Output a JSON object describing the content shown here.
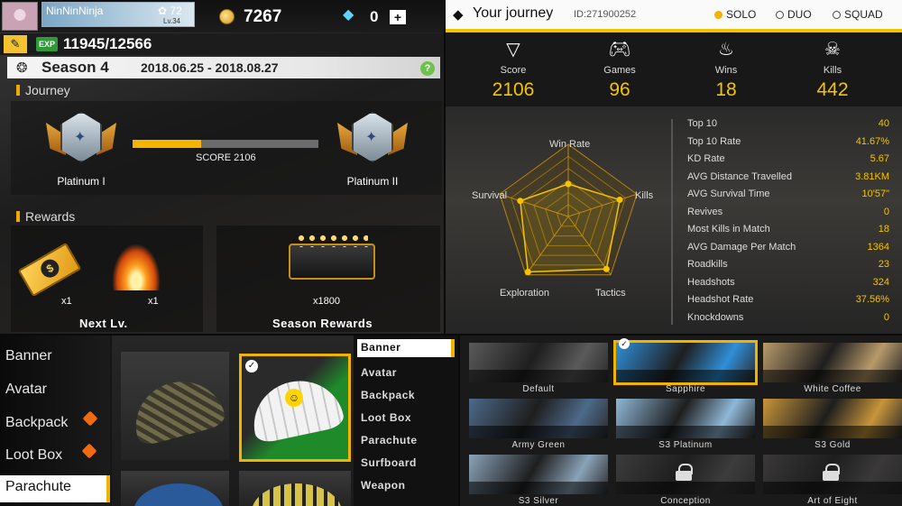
{
  "season_panel": {
    "player_name": "NinNinNinja",
    "likes": "72",
    "level": "Lv.34",
    "coins": "7267",
    "diamonds": "0",
    "plus": "+",
    "exp_tag": "EXP",
    "exp_value": "11945/12566",
    "season_title": "Season 4",
    "season_dates": "2018.06.25 - 2018.08.27",
    "help": "?",
    "journey_title": "Journey",
    "current_rank": "Platinum I",
    "next_rank": "Platinum II",
    "score_label": "SCORE  2106",
    "score_progress": 0.37,
    "rewards_title": "Rewards",
    "next_level": {
      "label": "Next Lv.",
      "items": [
        {
          "icon": "ticket-icon",
          "qty": "x1"
        },
        {
          "icon": "campfire-icon",
          "qty": "x1"
        }
      ]
    },
    "season_rewards": {
      "label": "Season Rewards",
      "icon": "gold-chest-icon",
      "qty": "x1800"
    },
    "colors": {
      "accent": "#f4b400",
      "exp": "#2e9a39"
    }
  },
  "journey_panel": {
    "title": "Your journey",
    "id": "ID:271900252",
    "modes": [
      {
        "label": "SOLO",
        "selected": true
      },
      {
        "label": "DUO",
        "selected": false
      },
      {
        "label": "SQUAD",
        "selected": false
      }
    ],
    "summary": [
      {
        "icon": "score-icon",
        "label": "Score",
        "value": "2106"
      },
      {
        "icon": "gamepad-icon",
        "label": "Games",
        "value": "96"
      },
      {
        "icon": "chicken-dinner-icon",
        "label": "Wins",
        "value": "18"
      },
      {
        "icon": "skull-icon",
        "label": "Kills",
        "value": "442"
      }
    ],
    "radar": {
      "axes": [
        "Win Rate",
        "Kills",
        "Tactics",
        "Exploration",
        "Survival"
      ],
      "values": [
        0.45,
        0.75,
        0.9,
        0.95,
        0.7
      ]
    },
    "stats": [
      {
        "label": "Top 10",
        "value": "40"
      },
      {
        "label": "Top 10 Rate",
        "value": "41.67%"
      },
      {
        "label": "KD Rate",
        "value": "5.67"
      },
      {
        "label": "AVG Distance Travelled",
        "value": "3.81KM"
      },
      {
        "label": "AVG Survival Time",
        "value": "10'57\""
      },
      {
        "label": "Revives",
        "value": "0"
      },
      {
        "label": "Most Kills in Match",
        "value": "18"
      },
      {
        "label": "AVG Damage Per Match",
        "value": "1364"
      },
      {
        "label": "Roadkills",
        "value": "23"
      },
      {
        "label": "Headshots",
        "value": "324"
      },
      {
        "label": "Headshot Rate",
        "value": "37.56%"
      },
      {
        "label": "Knockdowns",
        "value": "0"
      }
    ],
    "colors": {
      "accent": "#f5c400"
    }
  },
  "parachute_panel": {
    "nav": [
      {
        "label": "Banner",
        "badge": false,
        "selected": false
      },
      {
        "label": "Avatar",
        "badge": false,
        "selected": false
      },
      {
        "label": "Backpack",
        "badge": true,
        "selected": false
      },
      {
        "label": "Loot Box",
        "badge": true,
        "selected": false
      },
      {
        "label": "Parachute",
        "badge": false,
        "selected": true
      }
    ],
    "items": [
      {
        "name": "camo-parachute",
        "selected": false
      },
      {
        "name": "smiley-parachute",
        "selected": true
      },
      {
        "name": "blue-parachute",
        "selected": false
      },
      {
        "name": "yellow-parachute",
        "selected": false
      }
    ],
    "categories": [
      {
        "label": "Banner",
        "selected": true
      },
      {
        "label": "Avatar",
        "selected": false
      },
      {
        "label": "Backpack",
        "selected": false
      },
      {
        "label": "Loot Box",
        "selected": false
      },
      {
        "label": "Parachute",
        "selected": false
      },
      {
        "label": "Surfboard",
        "selected": false
      },
      {
        "label": "Weapon",
        "selected": false
      }
    ]
  },
  "banner_panel": {
    "banners": [
      {
        "label": "Default",
        "selected": false,
        "locked": false,
        "color": "#5a5a5a"
      },
      {
        "label": "Sapphire",
        "selected": true,
        "locked": false,
        "color": "#2f8fd8"
      },
      {
        "label": "White Coffee",
        "selected": false,
        "locked": false,
        "color": "#b89a6a"
      },
      {
        "label": "Army Green",
        "selected": false,
        "locked": false,
        "color": "#4d6a8a"
      },
      {
        "label": "S3 Platinum",
        "selected": false,
        "locked": false,
        "color": "#8fb8d8"
      },
      {
        "label": "S3 Gold",
        "selected": false,
        "locked": false,
        "color": "#c7953a"
      },
      {
        "label": "S3 Silver",
        "selected": false,
        "locked": false,
        "color": "#8aa3b8"
      },
      {
        "label": "Conception",
        "selected": false,
        "locked": true,
        "color": "#3c3c3c"
      },
      {
        "label": "Art of Eight",
        "selected": false,
        "locked": true,
        "color": "#3a3838"
      }
    ]
  }
}
